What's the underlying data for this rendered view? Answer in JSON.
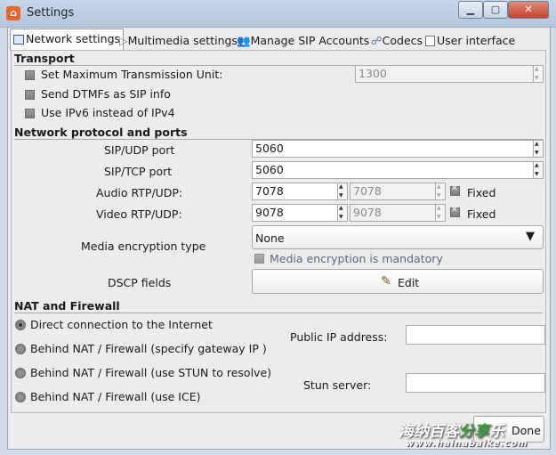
{
  "window": {
    "title": "Settings",
    "app_icon": "linphone-icon",
    "controls": [
      "minimize-icon",
      "maximize-icon",
      "close-icon"
    ]
  },
  "tabs": [
    {
      "label": "Network settings",
      "icon": "network-icon",
      "active": true
    },
    {
      "label": "Multimedia settings",
      "icon": "play-icon",
      "active": false
    },
    {
      "label": "Manage SIP Accounts",
      "icon": "accounts-icon",
      "active": false
    },
    {
      "label": "Codecs",
      "icon": "codecs-icon",
      "active": false
    },
    {
      "label": "User interface",
      "icon": "ui-icon",
      "active": false
    }
  ],
  "transport": {
    "title": "Transport",
    "mtu_label": "Set Maximum Transmission Unit:",
    "mtu_value": "1300",
    "dtmf_label": "Send DTMFs as SIP info",
    "ipv6_label": "Use IPv6 instead of IPv4"
  },
  "network": {
    "title": "Network protocol and ports",
    "udp_label": "SIP/UDP port",
    "udp_value": "5060",
    "tcp_label": "SIP/TCP port",
    "tcp_value": "5060",
    "audio_label": "Audio RTP/UDP:",
    "audio_value": "7078",
    "audio_value2": "7078",
    "audio_fixed_label": "Fixed",
    "video_label": "Video RTP/UDP:",
    "video_value": "9078",
    "video_value2": "9078",
    "video_fixed_label": "Fixed",
    "encryption_label": "Media encryption type",
    "encryption_value": "None",
    "mandatory_label": "Media encryption is mandatory",
    "dscp_label": "DSCP fields",
    "edit_label": "Edit"
  },
  "nat": {
    "title": "NAT and Firewall",
    "options": [
      "Direct connection to the Internet",
      "Behind NAT / Firewall (specify gateway IP )",
      "Behind NAT / Firewall (use STUN to resolve)",
      "Behind NAT / Firewall (use ICE)"
    ],
    "public_ip_label": "Public IP address:",
    "stun_label": "Stun server:"
  },
  "footer": {
    "done_label": "Done"
  },
  "watermark": {
    "text1": "海纳百客",
    "text2": "分享",
    "text3": "乐",
    "url": "www.hainabaike.com"
  },
  "colors": {
    "titlebar": "#b9cbe0",
    "panel": "#ececec",
    "close": "#c7472f"
  }
}
